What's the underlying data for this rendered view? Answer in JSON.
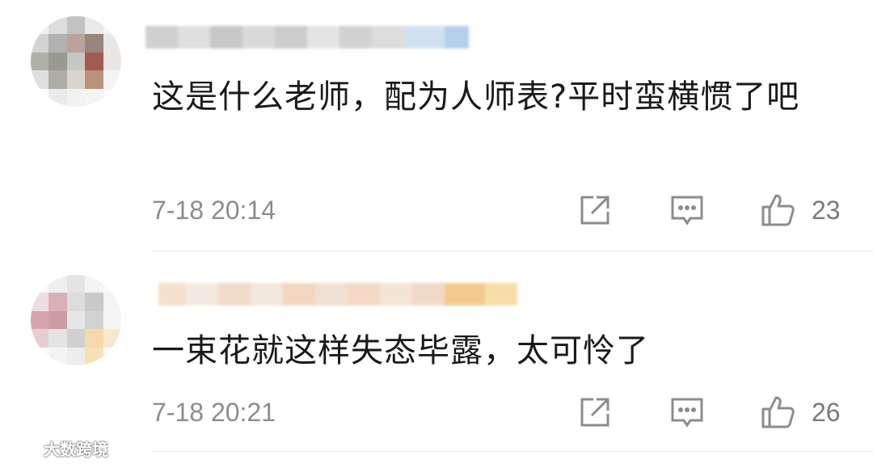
{
  "comments": [
    {
      "text": "这是什么老师，配为人师表?平时蛮横惯了吧",
      "time": "7-18 20:14",
      "likes": "23"
    },
    {
      "text": "一束花就这样失态毕露，太可怜了",
      "time": "7-18 20:21",
      "likes": "26"
    }
  ],
  "icons": {
    "share": "share-icon",
    "comment": "comment-icon",
    "like": "thumbs-up-icon"
  },
  "watermark": {
    "text": "大数跨境"
  },
  "colors": {
    "text": "#1a1a1a",
    "meta": "#8c8c8c",
    "icon": "#8c8c8c"
  }
}
